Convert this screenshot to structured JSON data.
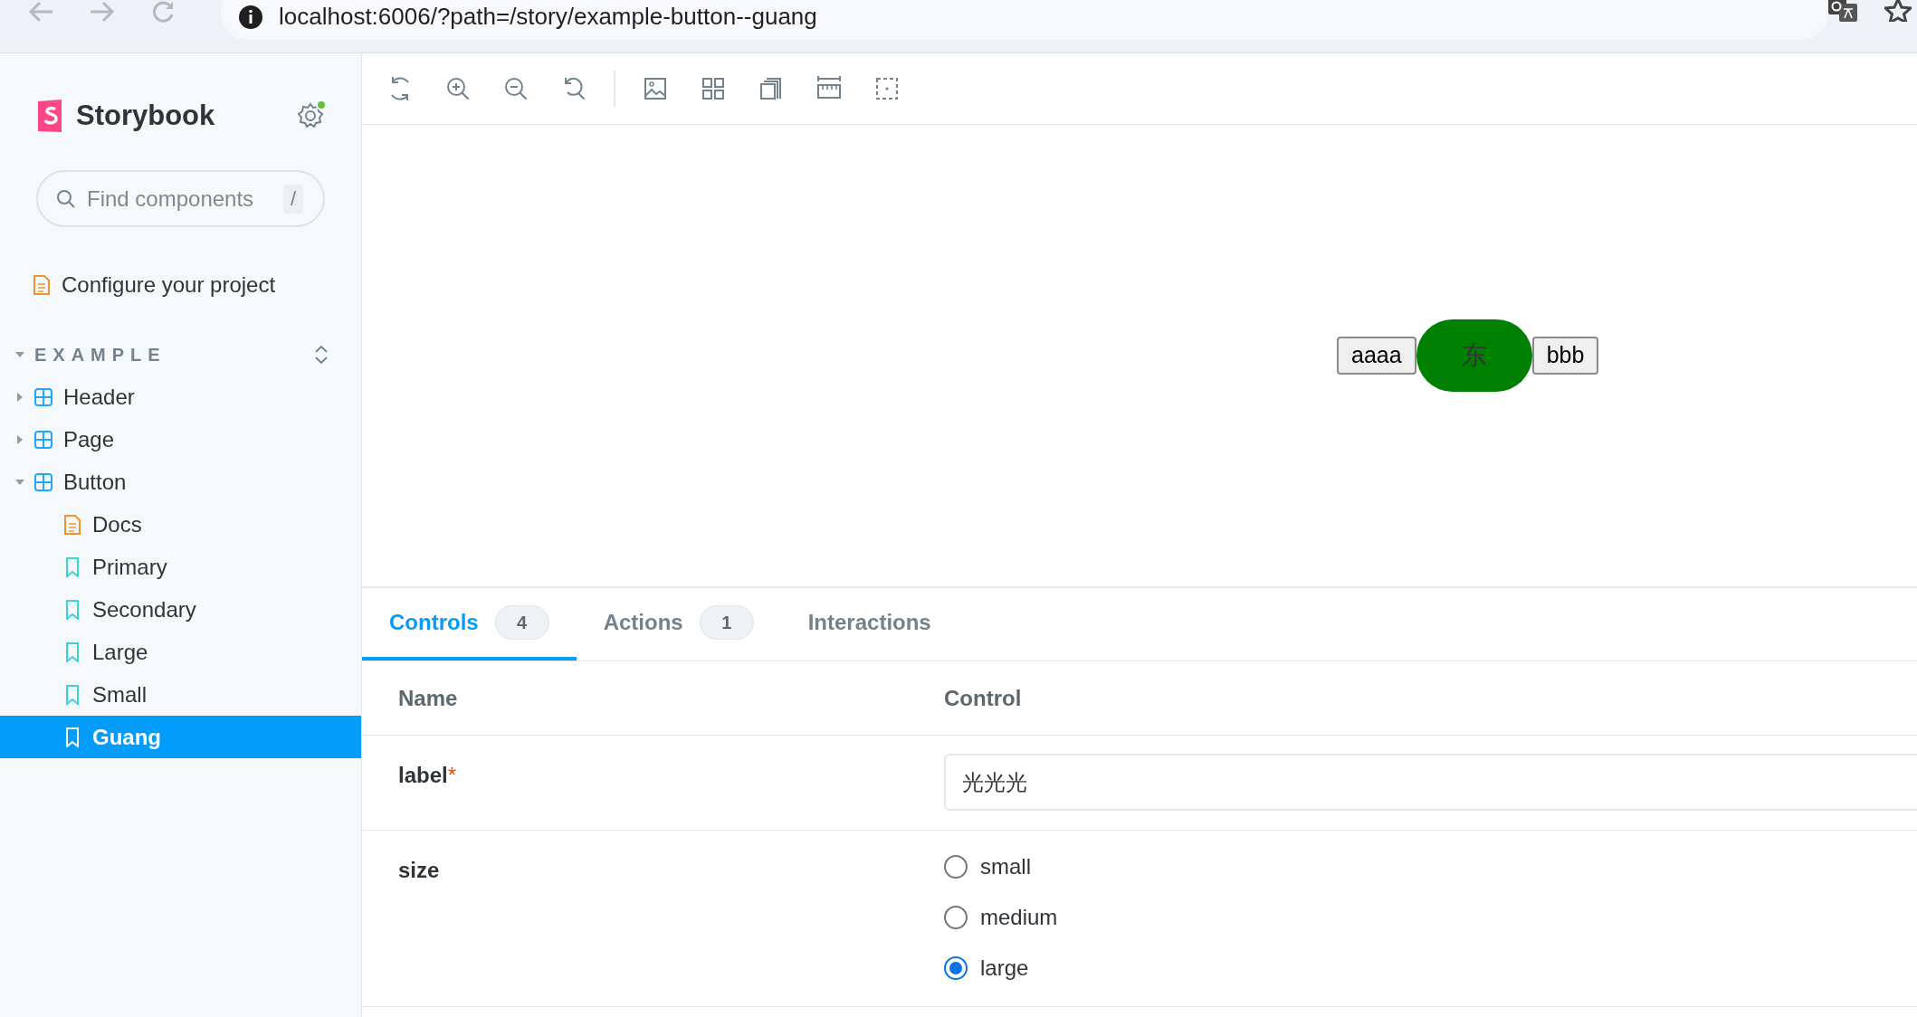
{
  "browser": {
    "url": "localhost:6006/?path=/story/example-button--guang"
  },
  "sidebar": {
    "brand": "Storybook",
    "settings_notification": true,
    "search": {
      "placeholder": "Find components",
      "shortcut": "/"
    },
    "top_items": [
      {
        "kind": "docs",
        "label": "Configure your project",
        "selected": false
      }
    ],
    "group": {
      "label": "EXAMPLE",
      "expanded": true,
      "children": [
        {
          "kind": "component",
          "label": "Header",
          "expanded": false,
          "selected": false
        },
        {
          "kind": "component",
          "label": "Page",
          "expanded": false,
          "selected": false
        },
        {
          "kind": "component",
          "label": "Button",
          "expanded": true,
          "selected": false,
          "children": [
            {
              "kind": "docs",
              "label": "Docs",
              "selected": false
            },
            {
              "kind": "story",
              "label": "Primary",
              "selected": false
            },
            {
              "kind": "story",
              "label": "Secondary",
              "selected": false
            },
            {
              "kind": "story",
              "label": "Large",
              "selected": false
            },
            {
              "kind": "story",
              "label": "Small",
              "selected": false
            },
            {
              "kind": "story",
              "label": "Guang",
              "selected": true
            }
          ]
        }
      ]
    }
  },
  "preview": {
    "buttons": [
      {
        "kind": "plain",
        "label": "aaaa"
      },
      {
        "kind": "pill",
        "label": "东"
      },
      {
        "kind": "plain",
        "label": "bbb"
      }
    ]
  },
  "panel": {
    "tabs": [
      {
        "label": "Controls",
        "count": "4",
        "selected": true
      },
      {
        "label": "Actions",
        "count": "1",
        "selected": false
      },
      {
        "label": "Interactions",
        "selected": false
      }
    ],
    "columns": [
      "Name",
      "Control"
    ],
    "rows": [
      {
        "kind": "text",
        "name": "label",
        "required_mark": "*",
        "value": "光光光"
      },
      {
        "kind": "radio",
        "name": "size",
        "options": [
          {
            "label": "small",
            "selected": false
          },
          {
            "label": "medium",
            "selected": false
          },
          {
            "label": "large",
            "selected": true
          }
        ]
      }
    ]
  }
}
